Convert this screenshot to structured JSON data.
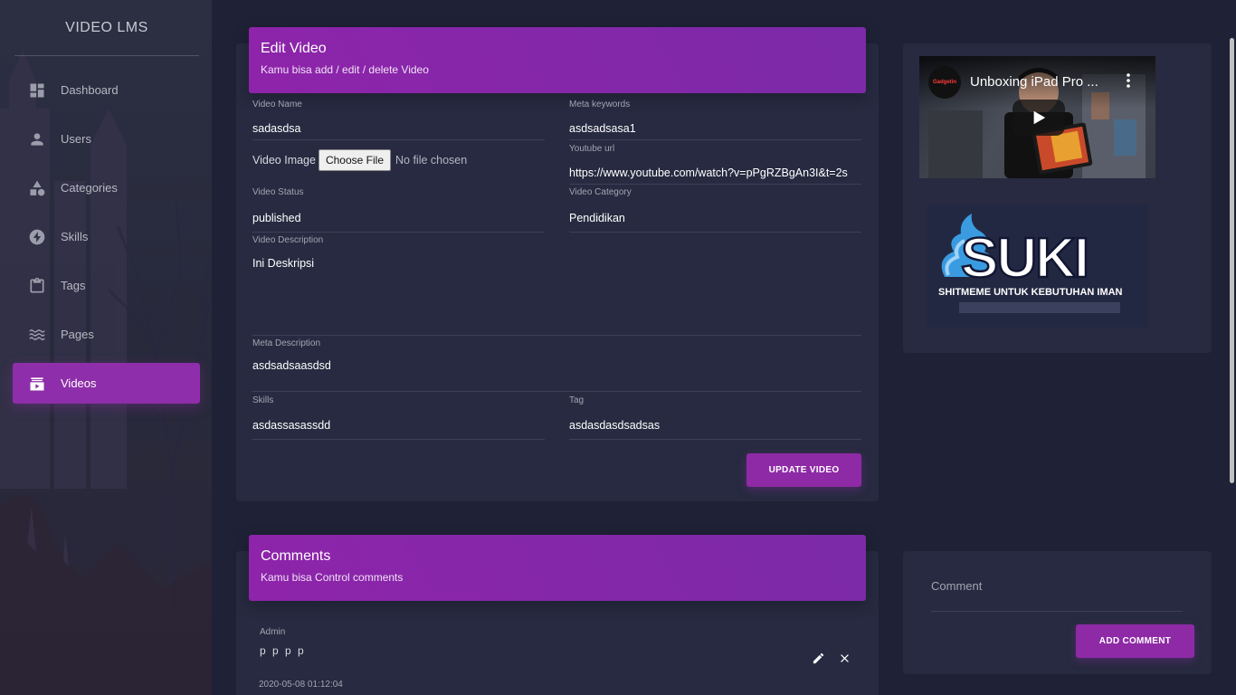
{
  "app": {
    "brand": "VIDEO LMS",
    "accent": "#8e24aa"
  },
  "sidebar": {
    "items": [
      {
        "label": "Dashboard",
        "icon": "dashboard-icon",
        "active": false
      },
      {
        "label": "Users",
        "icon": "person-icon",
        "active": false
      },
      {
        "label": "Categories",
        "icon": "category-icon",
        "active": false
      },
      {
        "label": "Skills",
        "icon": "bolt-icon",
        "active": false
      },
      {
        "label": "Tags",
        "icon": "clipboard-icon",
        "active": false
      },
      {
        "label": "Pages",
        "icon": "waves-icon",
        "active": false
      },
      {
        "label": "Videos",
        "icon": "video-library-icon",
        "active": true
      }
    ]
  },
  "edit_video": {
    "title": "Edit Video",
    "subtitle": "Kamu bisa add / edit / delete Video",
    "fields": {
      "video_name": {
        "label": "Video Name",
        "value": "sadasdsa"
      },
      "meta_keywords": {
        "label": "Meta keywords",
        "value": "asdsadsasa1"
      },
      "video_image": {
        "label": "Video Image",
        "button": "Choose File",
        "status": "No file chosen"
      },
      "youtube_url": {
        "label": "Youtube url",
        "value": "https://www.youtube.com/watch?v=pPgRZBgAn3I&t=2s"
      },
      "video_status": {
        "label": "Video Status",
        "value": "published"
      },
      "video_category": {
        "label": "Video Category",
        "value": "Pendidikan"
      },
      "video_description": {
        "label": "Video Description",
        "value": "Ini Deskripsi"
      },
      "meta_description": {
        "label": "Meta Description",
        "value": "asdsadsaasdsd"
      },
      "skills": {
        "label": "Skills",
        "value": "asdassasassdd"
      },
      "tag": {
        "label": "Tag",
        "value": "asdasdasdsadsas"
      }
    },
    "submit_label": "UPDATE VIDEO"
  },
  "preview": {
    "video_title": "Unboxing iPad Pro ...",
    "channel_badge": "Gadgetin"
  },
  "comments": {
    "title": "Comments",
    "subtitle": "Kamu bisa Control comments",
    "items": [
      {
        "author": "Admin",
        "body": "p p p p",
        "date": "2020-05-08 01:12:04"
      }
    ]
  },
  "add_comment": {
    "placeholder": "Comment",
    "button_label": "ADD COMMENT"
  }
}
